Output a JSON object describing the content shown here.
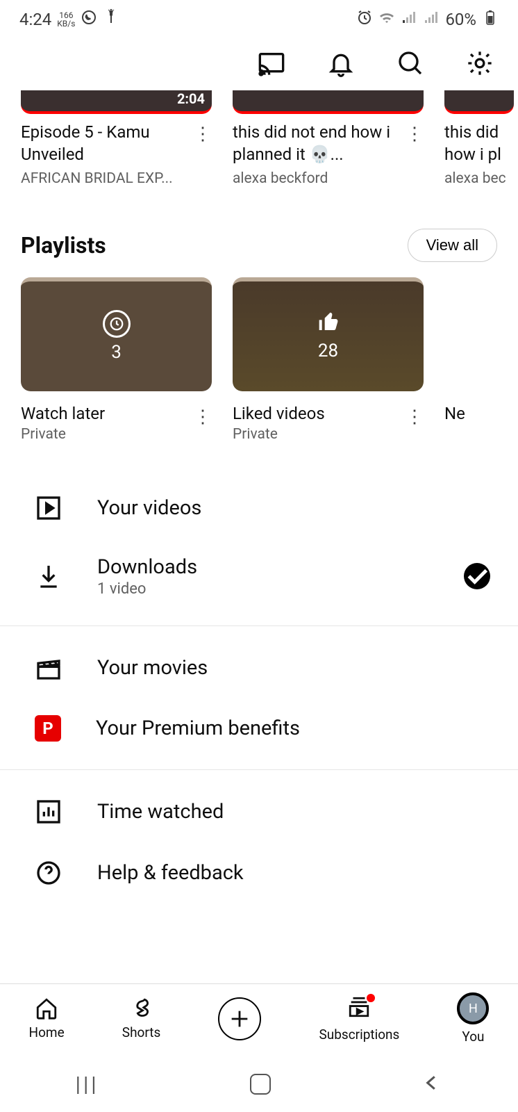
{
  "status": {
    "time": "4:24",
    "kbs_top": "166",
    "kbs_bot": "KB/s",
    "battery": "60%"
  },
  "videos": [
    {
      "duration": "2:04",
      "title": "Episode 5 - Kamu Unveiled",
      "channel": "AFRICAN BRIDAL EXP..."
    },
    {
      "title": "this did not end how i planned it 💀...",
      "channel": "alexa beckford"
    },
    {
      "title": "this did not end how i planned it",
      "channel": "alexa beckford"
    }
  ],
  "playlists_header": "Playlists",
  "viewall_label": "View all",
  "playlists": [
    {
      "count": "3",
      "title": "Watch later",
      "privacy": "Private"
    },
    {
      "count": "28",
      "title": "Liked videos",
      "privacy": "Private"
    },
    {
      "title": "Ne",
      "privacy": ""
    }
  ],
  "menu": {
    "your_videos": "Your videos",
    "downloads": "Downloads",
    "downloads_sub": "1 video",
    "your_movies": "Your movies",
    "premium": "Your Premium benefits",
    "time_watched": "Time watched",
    "help": "Help & feedback"
  },
  "nav": {
    "home": "Home",
    "shorts": "Shorts",
    "subs": "Subscriptions",
    "you": "You",
    "avatar_letter": "H"
  }
}
